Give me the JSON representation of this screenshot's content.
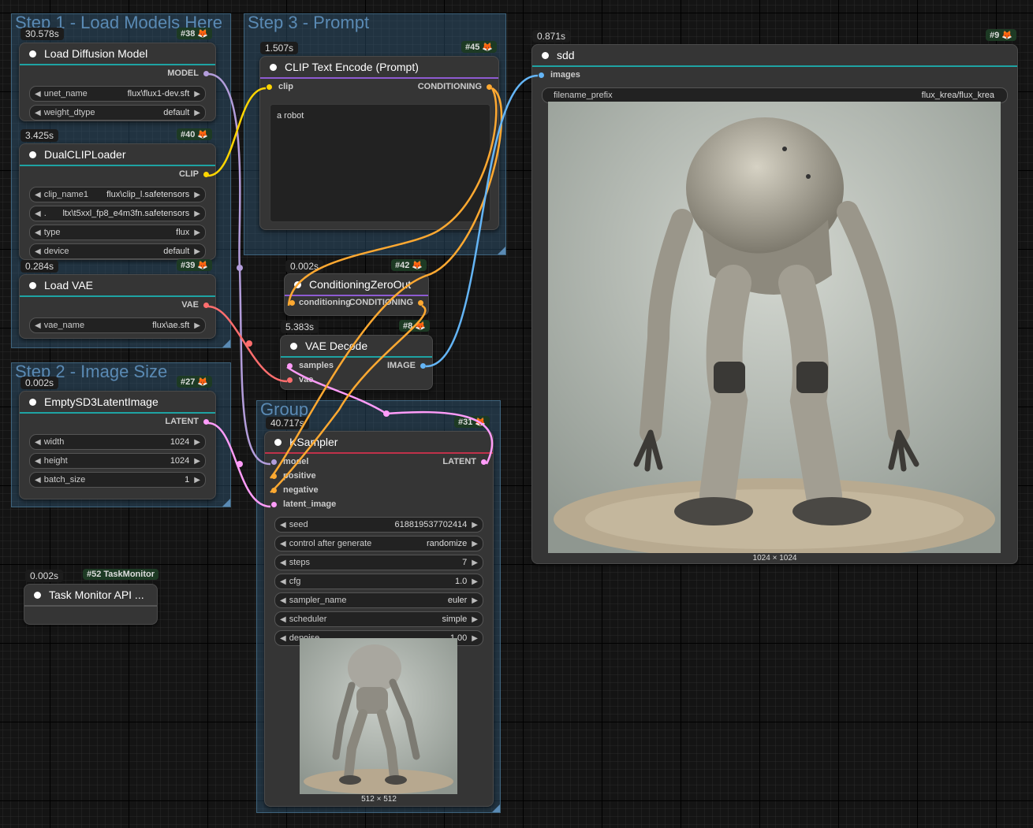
{
  "groups": {
    "step1": "Step 1 - Load Models Here",
    "step2": "Step 2 - Image Size",
    "step3": "Step 3 - Prompt",
    "group": "Group"
  },
  "nodes": {
    "load_diffusion": {
      "time": "30.578s",
      "id": "#38",
      "title": "Load Diffusion Model",
      "output": "MODEL",
      "widgets": [
        {
          "name": "unet_name",
          "value": "flux\\flux1-dev.sft"
        },
        {
          "name": "weight_dtype",
          "value": "default"
        }
      ]
    },
    "dual_clip": {
      "time": "3.425s",
      "id": "#40",
      "title": "DualCLIPLoader",
      "output": "CLIP",
      "widgets": [
        {
          "name": "clip_name1",
          "value": "flux\\clip_l.safetensors"
        },
        {
          "name": ".",
          "value": "ltx\\t5xxl_fp8_e4m3fn.safetensors"
        },
        {
          "name": "type",
          "value": "flux"
        },
        {
          "name": "device",
          "value": "default"
        }
      ]
    },
    "load_vae": {
      "time": "0.284s",
      "id": "#39",
      "title": "Load VAE",
      "output": "VAE",
      "widgets": [
        {
          "name": "vae_name",
          "value": "flux\\ae.sft"
        }
      ]
    },
    "empty_latent": {
      "time": "0.002s",
      "id": "#27",
      "title": "EmptySD3LatentImage",
      "output": "LATENT",
      "widgets": [
        {
          "name": "width",
          "value": "1024"
        },
        {
          "name": "height",
          "value": "1024"
        },
        {
          "name": "batch_size",
          "value": "1"
        }
      ]
    },
    "clip_text": {
      "time": "1.507s",
      "id": "#45",
      "title": "CLIP Text Encode (Prompt)",
      "input": "clip",
      "output": "CONDITIONING",
      "text": "a robot"
    },
    "cond_zero": {
      "time": "0.002s",
      "id": "#42",
      "title": "ConditioningZeroOut",
      "input": "conditioning",
      "output": "CONDITIONING"
    },
    "vae_decode": {
      "time": "5.383s",
      "id": "#8",
      "title": "VAE Decode",
      "inputs": [
        "samples",
        "vae"
      ],
      "output": "IMAGE"
    },
    "ksampler": {
      "time": "40.717s",
      "id": "#31",
      "title": "KSampler",
      "inputs": [
        "model",
        "positive",
        "negative",
        "latent_image"
      ],
      "output": "LATENT",
      "widgets": [
        {
          "name": "seed",
          "value": "618819537702414"
        },
        {
          "name": "control after generate",
          "value": "randomize"
        },
        {
          "name": "steps",
          "value": "7"
        },
        {
          "name": "cfg",
          "value": "1.0"
        },
        {
          "name": "sampler_name",
          "value": "euler"
        },
        {
          "name": "scheduler",
          "value": "simple"
        },
        {
          "name": "denoise",
          "value": "1.00"
        }
      ],
      "preview_caption": "512 × 512"
    },
    "save_image": {
      "time": "0.871s",
      "id": "#9",
      "title": "sdd",
      "input": "images",
      "widgets": [
        {
          "name": "filename_prefix",
          "value": "flux_krea/flux_krea"
        }
      ],
      "preview_caption": "1024 × 1024"
    },
    "task_monitor": {
      "time": "0.002s",
      "id": "#52 TaskMonitor",
      "title": "Task Monitor API ..."
    }
  },
  "colors": {
    "model": "#b39ddb",
    "clip": "#ffd500",
    "vae": "#ff6e6e",
    "latent": "#ff9cf9",
    "conditioning": "#ffa931",
    "image": "#64b5f6",
    "group": "#34607f",
    "node_bg": "#353535"
  },
  "icons": {
    "fox": "fox-icon",
    "arrow_left": "arrow-left-icon",
    "arrow_right": "arrow-right-icon",
    "status_dot": "status-dot-icon"
  }
}
